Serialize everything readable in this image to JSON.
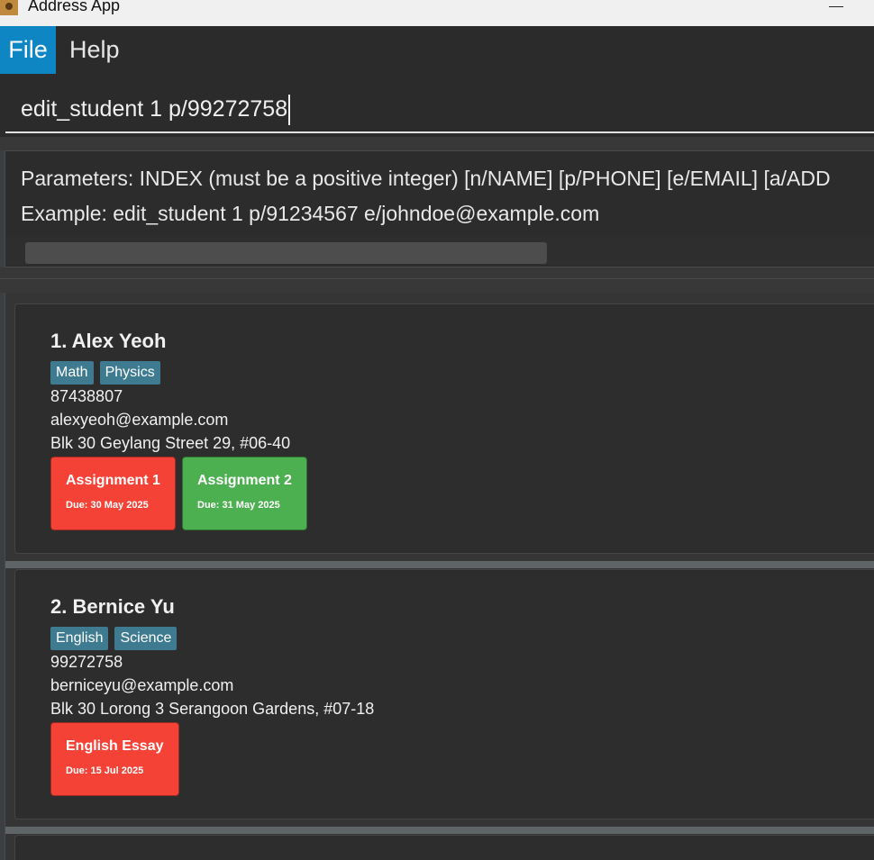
{
  "window": {
    "title": "Address App"
  },
  "menu": {
    "file": "File",
    "help": "Help"
  },
  "command": {
    "value": "edit_student 1 p/99272758"
  },
  "result": {
    "line1": "Parameters: INDEX (must be a positive integer) [n/NAME] [p/PHONE] [e/EMAIL] [a/ADD",
    "line2": "Example: edit_student 1 p/91234567 e/johndoe@example.com"
  },
  "students": [
    {
      "name": "1. Alex Yeoh",
      "tags": [
        "Math",
        "Physics"
      ],
      "phone": "87438807",
      "email": "alexyeoh@example.com",
      "address": "Blk 30 Geylang Street 29, #06-40",
      "assignments": [
        {
          "title": "Assignment 1",
          "due": "Due: 30 May 2025",
          "color": "#f44336"
        },
        {
          "title": "Assignment 2",
          "due": "Due: 31 May 2025",
          "color": "#4caf50"
        }
      ]
    },
    {
      "name": "2. Bernice Yu",
      "tags": [
        "English",
        "Science"
      ],
      "phone": "99272758",
      "email": "berniceyu@example.com",
      "address": "Blk 30 Lorong 3 Serangoon Gardens, #07-18",
      "assignments": [
        {
          "title": "English Essay",
          "due": "Due: 15 Jul 2025",
          "color": "#f44336"
        }
      ]
    }
  ],
  "colors": {
    "accent": "#0f86c4",
    "tag": "#3e7b91",
    "overdue": "#f44336",
    "upcoming": "#4caf50"
  }
}
